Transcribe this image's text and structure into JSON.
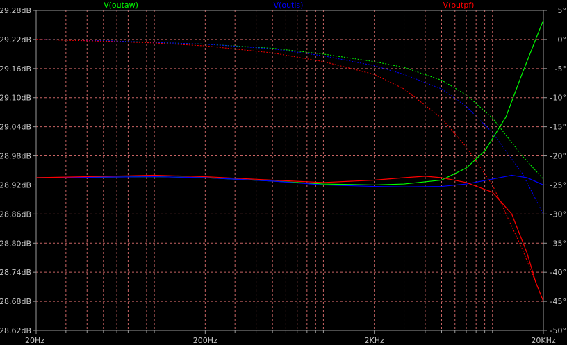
{
  "chart_data": {
    "type": "line",
    "x_scale": "log",
    "xlim": [
      20,
      20000
    ],
    "ylim": [
      28.62,
      29.28
    ],
    "ylim_right": [
      -50,
      5
    ],
    "grid": true,
    "colors": {
      "background": "#000000",
      "grid": "#c86464",
      "axis": "#9a9a9a",
      "text": "#c8c8c8"
    },
    "x_ticks": [
      {
        "label": "20Hz",
        "value": 20
      },
      {
        "label": "200Hz",
        "value": 200
      },
      {
        "label": "2KHz",
        "value": 2000
      },
      {
        "label": "20KHz",
        "value": 20000
      }
    ],
    "x_minor": [
      30,
      40,
      50,
      60,
      70,
      80,
      90,
      100,
      300,
      400,
      500,
      600,
      700,
      800,
      900,
      1000,
      3000,
      4000,
      5000,
      6000,
      7000,
      8000,
      9000,
      10000
    ],
    "y_ticks": [
      {
        "label": "29.28dB",
        "value": 29.28
      },
      {
        "label": "29.22dB",
        "value": 29.22
      },
      {
        "label": "29.16dB",
        "value": 29.16
      },
      {
        "label": "29.10dB",
        "value": 29.1
      },
      {
        "label": "29.04dB",
        "value": 29.04
      },
      {
        "label": "28.98dB",
        "value": 28.98
      },
      {
        "label": "28.92dB",
        "value": 28.92
      },
      {
        "label": "28.86dB",
        "value": 28.86
      },
      {
        "label": "28.80dB",
        "value": 28.8
      },
      {
        "label": "28.74dB",
        "value": 28.74
      },
      {
        "label": "28.68dB",
        "value": 28.68
      },
      {
        "label": "28.62dB",
        "value": 28.62
      }
    ],
    "y_ticks_right": [
      {
        "label": "5°",
        "value": 5
      },
      {
        "label": "0°",
        "value": 0
      },
      {
        "label": "-5°",
        "value": -5
      },
      {
        "label": "-10°",
        "value": -10
      },
      {
        "label": "-15°",
        "value": -15
      },
      {
        "label": "-20°",
        "value": -20
      },
      {
        "label": "-25°",
        "value": -25
      },
      {
        "label": "-30°",
        "value": -30
      },
      {
        "label": "-35°",
        "value": -35
      },
      {
        "label": "-40°",
        "value": -40
      },
      {
        "label": "-45°",
        "value": -45
      },
      {
        "label": "-50°",
        "value": -50
      }
    ],
    "series": [
      {
        "name": "V(outaw)",
        "color": "#00ff00",
        "magnitude_db": [
          [
            20,
            28.935
          ],
          [
            100,
            28.937
          ],
          [
            200,
            28.935
          ],
          [
            500,
            28.928
          ],
          [
            1000,
            28.922
          ],
          [
            2000,
            28.92
          ],
          [
            3000,
            28.922
          ],
          [
            5000,
            28.93
          ],
          [
            7000,
            28.955
          ],
          [
            9000,
            28.99
          ],
          [
            12000,
            29.06
          ],
          [
            15000,
            29.15
          ],
          [
            18000,
            29.22
          ],
          [
            20000,
            29.26
          ]
        ],
        "phase_deg": [
          [
            20,
            0.0
          ],
          [
            50,
            -0.2
          ],
          [
            100,
            -0.5
          ],
          [
            200,
            -0.8
          ],
          [
            500,
            -1.5
          ],
          [
            1000,
            -2.5
          ],
          [
            2000,
            -3.8
          ],
          [
            3000,
            -4.8
          ],
          [
            5000,
            -7.0
          ],
          [
            7000,
            -9.5
          ],
          [
            10000,
            -13.5
          ],
          [
            15000,
            -20.0
          ],
          [
            20000,
            -24.0
          ]
        ]
      },
      {
        "name": "V(outls)",
        "color": "#0000ff",
        "magnitude_db": [
          [
            20,
            28.935
          ],
          [
            100,
            28.937
          ],
          [
            200,
            28.935
          ],
          [
            500,
            28.928
          ],
          [
            1000,
            28.92
          ],
          [
            2000,
            28.917
          ],
          [
            3000,
            28.916
          ],
          [
            5000,
            28.917
          ],
          [
            7000,
            28.922
          ],
          [
            10000,
            28.932
          ],
          [
            13000,
            28.94
          ],
          [
            16000,
            28.935
          ],
          [
            20000,
            28.92
          ]
        ],
        "phase_deg": [
          [
            20,
            0.0
          ],
          [
            50,
            -0.2
          ],
          [
            100,
            -0.5
          ],
          [
            200,
            -0.8
          ],
          [
            500,
            -1.6
          ],
          [
            1000,
            -2.8
          ],
          [
            2000,
            -4.5
          ],
          [
            3000,
            -6.0
          ],
          [
            5000,
            -8.5
          ],
          [
            7000,
            -11.5
          ],
          [
            10000,
            -16.0
          ],
          [
            15000,
            -23.0
          ],
          [
            20000,
            -30.0
          ]
        ]
      },
      {
        "name": "V(outpf)",
        "color": "#ff0000",
        "magnitude_db": [
          [
            20,
            28.935
          ],
          [
            100,
            28.94
          ],
          [
            200,
            28.937
          ],
          [
            500,
            28.93
          ],
          [
            1000,
            28.925
          ],
          [
            2000,
            28.93
          ],
          [
            3000,
            28.935
          ],
          [
            4000,
            28.938
          ],
          [
            5000,
            28.935
          ],
          [
            7000,
            28.925
          ],
          [
            10000,
            28.905
          ],
          [
            13000,
            28.86
          ],
          [
            16000,
            28.78
          ],
          [
            18000,
            28.72
          ],
          [
            20000,
            28.68
          ]
        ],
        "phase_deg": [
          [
            20,
            0.0
          ],
          [
            50,
            -0.3
          ],
          [
            100,
            -0.6
          ],
          [
            200,
            -1.1
          ],
          [
            500,
            -2.3
          ],
          [
            1000,
            -3.8
          ],
          [
            2000,
            -6.0
          ],
          [
            3000,
            -8.5
          ],
          [
            5000,
            -13.5
          ],
          [
            7000,
            -18.5
          ],
          [
            10000,
            -25.0
          ],
          [
            15000,
            -36.0
          ],
          [
            20000,
            -45.0
          ]
        ]
      }
    ]
  }
}
